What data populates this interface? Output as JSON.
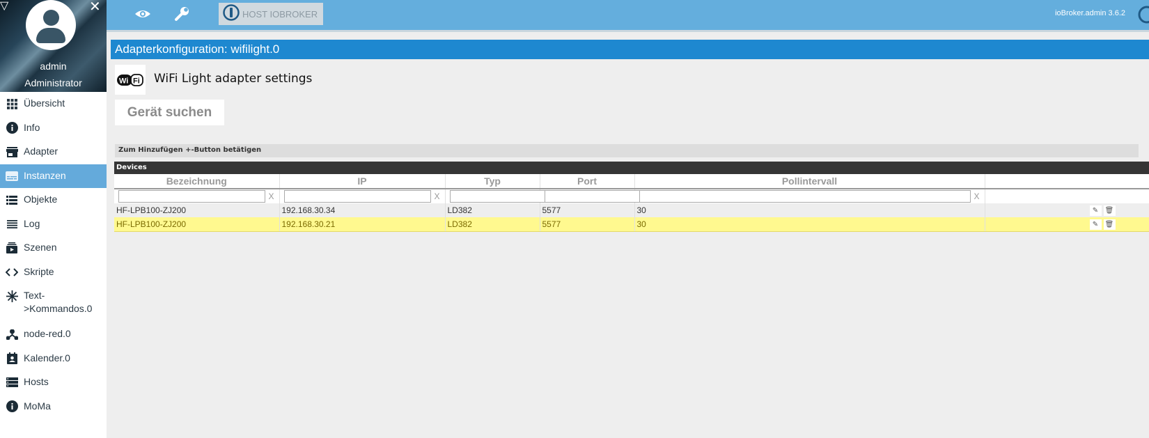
{
  "sidebar": {
    "user_name": "admin",
    "user_role": "Administrator",
    "items": [
      {
        "label": "Übersicht",
        "icon": "grid-icon",
        "active": false
      },
      {
        "label": "Info",
        "icon": "info-icon",
        "active": false
      },
      {
        "label": "Adapter",
        "icon": "store-icon",
        "active": false
      },
      {
        "label": "Instanzen",
        "icon": "instances-icon",
        "active": true
      },
      {
        "label": "Objekte",
        "icon": "list-icon",
        "active": false
      },
      {
        "label": "Log",
        "icon": "menu-lines-icon",
        "active": false
      },
      {
        "label": "Szenen",
        "icon": "scenes-icon",
        "active": false
      },
      {
        "label": "Skripte",
        "icon": "code-icon",
        "active": false
      },
      {
        "label": "Text->Kommandos.0",
        "icon": "snowflake-icon",
        "active": false
      },
      {
        "label": "node-red.0",
        "icon": "node-icon",
        "active": false
      },
      {
        "label": "Kalender.0",
        "icon": "calendar-icon",
        "active": false
      },
      {
        "label": "Hosts",
        "icon": "hosts-icon",
        "active": false
      },
      {
        "label": "MoMa",
        "icon": "info-icon",
        "active": false
      }
    ]
  },
  "topbar": {
    "host_label": "HOST IOBROKER",
    "version": "ioBroker.admin 3.6.2"
  },
  "main": {
    "config_title": "Adapterkonfiguration: wifilight.0",
    "adapter_heading": "WiFi Light adapter settings",
    "logo_text": "WiFi",
    "search_button": "Gerät suchen",
    "hint": "Zum Hinzufügen +-Button betätigen",
    "table": {
      "title": "Devices",
      "columns": [
        "Bezeichnung",
        "IP",
        "Typ",
        "Port",
        "Pollintervall",
        ""
      ],
      "filter_clear": "X",
      "rows": [
        {
          "name": "HF-LPB100-ZJ200",
          "ip": "192.168.30.34",
          "type": "LD382",
          "port": "5577",
          "poll": "30"
        },
        {
          "name": "HF-LPB100-ZJ200",
          "ip": "192.168.30.21",
          "type": "LD382",
          "port": "5577",
          "poll": "30"
        }
      ]
    }
  },
  "colors": {
    "topbar": "#64aedd",
    "title_bar": "#1e88d0",
    "active_nav": "#64aadb",
    "selected_row": "#fff98f"
  }
}
